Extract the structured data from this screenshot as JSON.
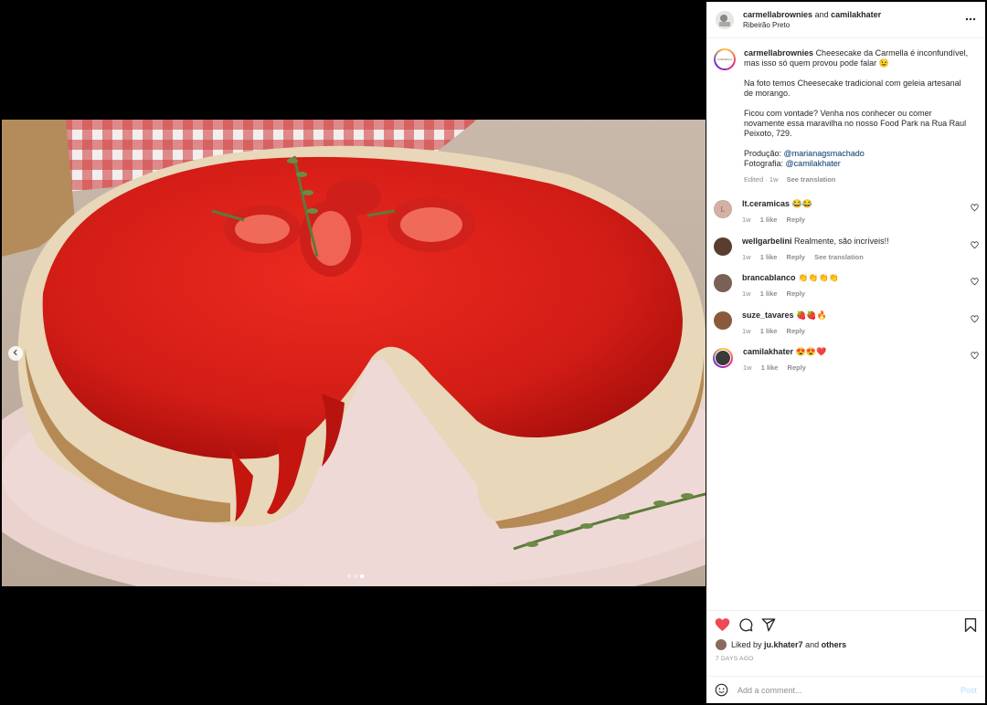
{
  "header": {
    "user1": "carmellabrownies",
    "conj": "and",
    "user2": "camilakhater",
    "location": "Ribeirão Preto"
  },
  "caption": {
    "username": "carmellabrownies",
    "line1": "Cheesecake da Carmella é inconfundível, mas isso só quem provou pode falar 😉",
    "line2": "Na foto temos Cheesecake tradicional com geleia artesanal de morango.",
    "line3": "Ficou com vontade? Venha nos conhecer ou comer novamente essa maravilha no nosso Food Park na Rua Raul Peixoto, 729.",
    "prod_label": "Produção:",
    "prod_user": "@marianagsmachado",
    "photo_label": "Fotografia:",
    "photo_user": "@camilakhater",
    "edited": "Edited · 1w",
    "see_translation": "See translation"
  },
  "comments": [
    {
      "user": "lt.ceramicas",
      "text": "😂😂",
      "time": "1w",
      "likes": "1 like",
      "reply": "Reply",
      "translate": ""
    },
    {
      "user": "wellgarbelini",
      "text": "Realmente, são incríveis!!",
      "time": "1w",
      "likes": "1 like",
      "reply": "Reply",
      "translate": "See translation"
    },
    {
      "user": "brancablanco",
      "text": "👏👏👏👏",
      "time": "1w",
      "likes": "1 like",
      "reply": "Reply",
      "translate": ""
    },
    {
      "user": "suze_tavares",
      "text": "🍓🍓🔥",
      "time": "1w",
      "likes": "1 like",
      "reply": "Reply",
      "translate": ""
    },
    {
      "user": "camilakhater",
      "text": "😍😍❤️",
      "time": "1w",
      "likes": "1 like",
      "reply": "Reply",
      "translate": ""
    }
  ],
  "likes": {
    "prefix": "Liked by",
    "user": "ju.khater7",
    "and": "and",
    "others": "others"
  },
  "time_ago": "7 DAYS AGO",
  "add_comment": {
    "placeholder": "Add a comment...",
    "post": "Post"
  },
  "carousel": {
    "count": 3,
    "active": 3
  },
  "colors": {
    "like_red": "#ed4956",
    "link": "#00376b",
    "post_disabled": "#b2dffc"
  }
}
